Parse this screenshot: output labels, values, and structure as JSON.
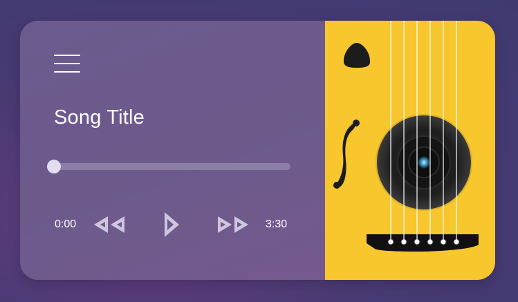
{
  "player": {
    "song_title": "Song Title",
    "current_time": "0:00",
    "total_time": "3:30",
    "progress": 0.0
  },
  "icons": {
    "menu": "hamburger-menu-icon",
    "rewind": "rewind-icon",
    "play": "play-icon",
    "fast_forward": "fast-forward-icon",
    "pick": "guitar-pick-icon",
    "f_hole": "f-hole-icon"
  },
  "colors": {
    "guitar_body": "#f8c62d",
    "panel": "#6b5b8e",
    "control_fill": "#cfc6dd"
  }
}
